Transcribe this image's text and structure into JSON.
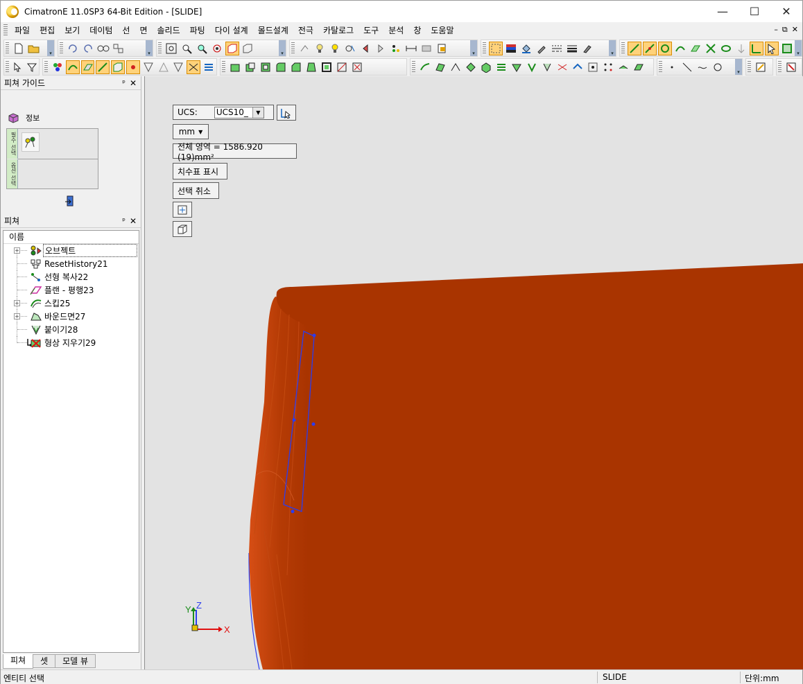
{
  "window": {
    "title": "CimatronE 11.0SP3 64-Bit Edition - [SLIDE]",
    "minimize": "—",
    "maximize": "☐",
    "close": "✕"
  },
  "menu": [
    "파일",
    "편집",
    "보기",
    "데이텀",
    "선",
    "면",
    "솔리드",
    "파팅",
    "다이 설계",
    "몰드설계",
    "전극",
    "카탈로그",
    "도구",
    "분석",
    "창",
    "도움말"
  ],
  "mdi_controls": [
    "–",
    "⧉",
    "✕"
  ],
  "feature_guide": {
    "title": "피쳐 가이드",
    "pin": "ᵖ",
    "close": "✕",
    "info_label": "정보",
    "tab1": "필수 선택",
    "tab2": "옵션 선택"
  },
  "features": {
    "title": "피쳐",
    "column_header": "이름",
    "items": [
      {
        "label": "오브젝트",
        "expandable": true,
        "selected": true
      },
      {
        "label": "ResetHistory21",
        "expandable": false
      },
      {
        "label": "선형 복사22",
        "expandable": false
      },
      {
        "label": "플랜 - 평행23",
        "expandable": false
      },
      {
        "label": "스킵25",
        "expandable": true
      },
      {
        "label": "바운드면27",
        "expandable": true
      },
      {
        "label": "붙이기28",
        "expandable": false
      },
      {
        "label": "형상 지우기29",
        "expandable": false
      }
    ],
    "bottom_tabs": [
      "피쳐",
      "셋",
      "모델 뷰"
    ]
  },
  "viewport": {
    "ucs_label": "UCS:",
    "ucs_value": "UCS10_",
    "unit_value": "mm",
    "area_text": "전체 영역 = 1586.920 (19)mm²",
    "show_dimensions": "치수표 표시",
    "deselect": "선택 취소",
    "axis_x": "X",
    "axis_y": "Y",
    "axis_z": "Z",
    "model_color": "#a93400",
    "background_color": "#e3e3e3"
  },
  "status": {
    "left": "엔티티 선택",
    "middle": "SLIDE",
    "right": "단위:mm"
  },
  "colors": {
    "toolbar_active": "#ffd27a",
    "selection_outline": "#2a3cf0"
  }
}
